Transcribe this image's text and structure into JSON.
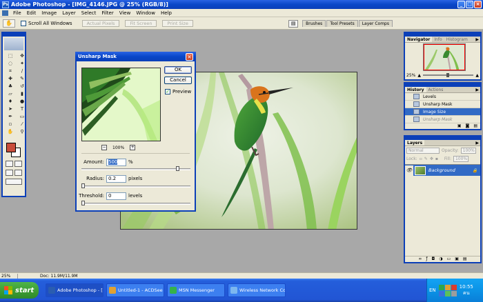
{
  "app": {
    "title": "Adobe Photoshop - [IMG_4146.JPG @ 25% (RGB/8)]",
    "window_buttons": [
      "_",
      "□",
      "×"
    ]
  },
  "menu": {
    "items": [
      "File",
      "Edit",
      "Image",
      "Layer",
      "Select",
      "Filter",
      "View",
      "Window",
      "Help"
    ]
  },
  "options": {
    "scroll_all_label": "Scroll All Windows",
    "actual_pixels": "Actual Pixels",
    "fit_screen": "Fit Screen",
    "print_size": "Print Size",
    "well_tabs": [
      "Brushes",
      "Tool Presets",
      "Layer Comps"
    ]
  },
  "dialog": {
    "title": "Unsharp Mask",
    "ok_label": "OK",
    "cancel_label": "Cancel",
    "preview_label": "Preview",
    "zoom": "100%",
    "amount_label": "Amount:",
    "amount_value": "500",
    "amount_unit": "%",
    "amount_slider_fraction": 0.9,
    "radius_label": "Radius:",
    "radius_value": "0.2",
    "radius_unit": "pixels",
    "radius_slider_fraction": 0.0,
    "threshold_label": "Threshold:",
    "threshold_value": "0",
    "threshold_unit": "levels",
    "threshold_slider_fraction": 0.0
  },
  "navigator": {
    "tabs": [
      "Navigator",
      "Info",
      "Histogram"
    ],
    "zoom": "25%"
  },
  "history": {
    "tabs": [
      "History",
      "Actions"
    ],
    "items": [
      "Levels",
      "Unsharp Mask",
      "Image Size",
      "Unsharp Mask"
    ]
  },
  "layers": {
    "tab": "Layers",
    "blend_mode": "Normal",
    "opacity_label": "Opacity:",
    "opacity_value": "100%",
    "lock_label": "Lock:",
    "fill_label": "Fill:",
    "fill_value": "100%",
    "layer_name": "Background"
  },
  "status": {
    "zoom": "25%",
    "doc": "Doc: 11.9M/11.9M"
  },
  "taskbar": {
    "start_label": "start",
    "tasks": [
      "Adobe Photoshop - [I...",
      "Untitled-1 - ACDSee ...",
      "MSN Messenger",
      "Wireless Network Co..."
    ],
    "lang": "EN",
    "time": "10:55",
    "ampm": "คน"
  },
  "colors": {
    "foreground": "#c94d3a",
    "background": "#ffffff",
    "accent": "#0b3fb8",
    "selection": "#316ac5"
  }
}
